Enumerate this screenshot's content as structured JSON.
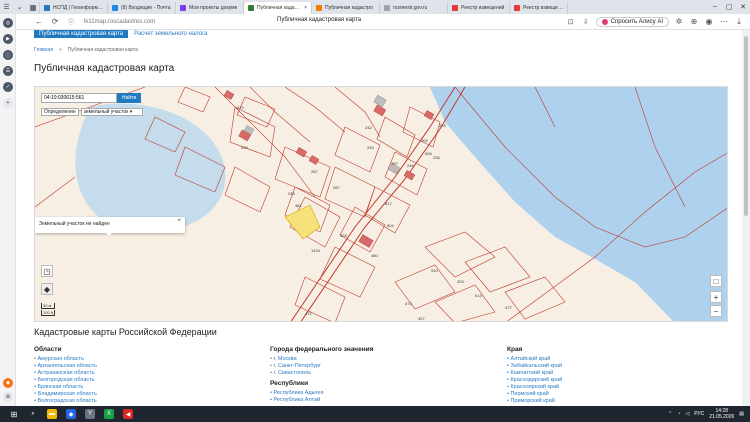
{
  "browser": {
    "tabs": [
      {
        "title": "",
        "color": "#6b7280"
      },
      {
        "title": "НСПД | Геоинформац",
        "color": "#1f7ac0"
      },
      {
        "title": "(8) Входящие - Почта",
        "color": "#1e88e5"
      },
      {
        "title": "Мои проекты докуме",
        "color": "#7c3aed"
      },
      {
        "title": "Публичная кадастр",
        "color": "#2e7d32",
        "active": true
      },
      {
        "title": "Публичная кадастро",
        "color": "#f57c00"
      },
      {
        "title": "rosreestr.gov.ru",
        "color": "#9ca3af"
      },
      {
        "title": "Реестр извещений",
        "color": "#e53935"
      },
      {
        "title": "Реестр извещений",
        "color": "#e53935"
      }
    ],
    "url": "lk11map.roscadastres.com",
    "page_title": "Публичная кадастровая карта",
    "alice_label": "Спросить Алису AI"
  },
  "subnav": {
    "active": "Публичная кадастровая карта",
    "other": "Расчет земельного налога"
  },
  "breadcrumbs": [
    "Главная",
    "Публичная кадастровая карта"
  ],
  "page": {
    "heading": "Публичная кадастровая карта"
  },
  "map": {
    "search_value": "04:10:030615:561",
    "search_button": "Найти",
    "definition_label": "Определение",
    "definition_value": "земельный участок",
    "popup_text": "Земельный участок не найден",
    "scale_top": "30 м",
    "scale_bottom": "100 ft",
    "parcel_numbers": [
      "223",
      "270",
      "242",
      "202",
      "243",
      "236",
      "297",
      "234",
      "267",
      "287",
      "245",
      "481",
      "617",
      "1424",
      "328",
      "604",
      "480",
      "246",
      "606",
      "910",
      "253",
      "473",
      "614",
      "327",
      "477",
      "471"
    ]
  },
  "regions": {
    "heading": "Кадастровые карты Российской Федерации",
    "oblasti": {
      "title": "Области",
      "items": [
        "Амурская область",
        "Архангельская область",
        "Астраханская область",
        "Белгородская область",
        "Брянская область",
        "Владимирская область",
        "Волгоградская область"
      ]
    },
    "cities": {
      "title": "Города федерального значения",
      "items": [
        "г. Москва",
        "г. Санкт-Петербург",
        "г. Севастополь"
      ]
    },
    "republics": {
      "title": "Республики",
      "items": [
        "Республика Адыгея",
        "Республика Алтай"
      ]
    },
    "krai": {
      "title": "Края",
      "items": [
        "Алтайский край",
        "Забайкальский край",
        "Камчатский край",
        "Краснодарский край",
        "Красноярский край",
        "Пермский край",
        "Приморский край"
      ]
    }
  },
  "taskbar": {
    "lang": "РУС",
    "time": "14:28",
    "date": "21.05.2026"
  }
}
